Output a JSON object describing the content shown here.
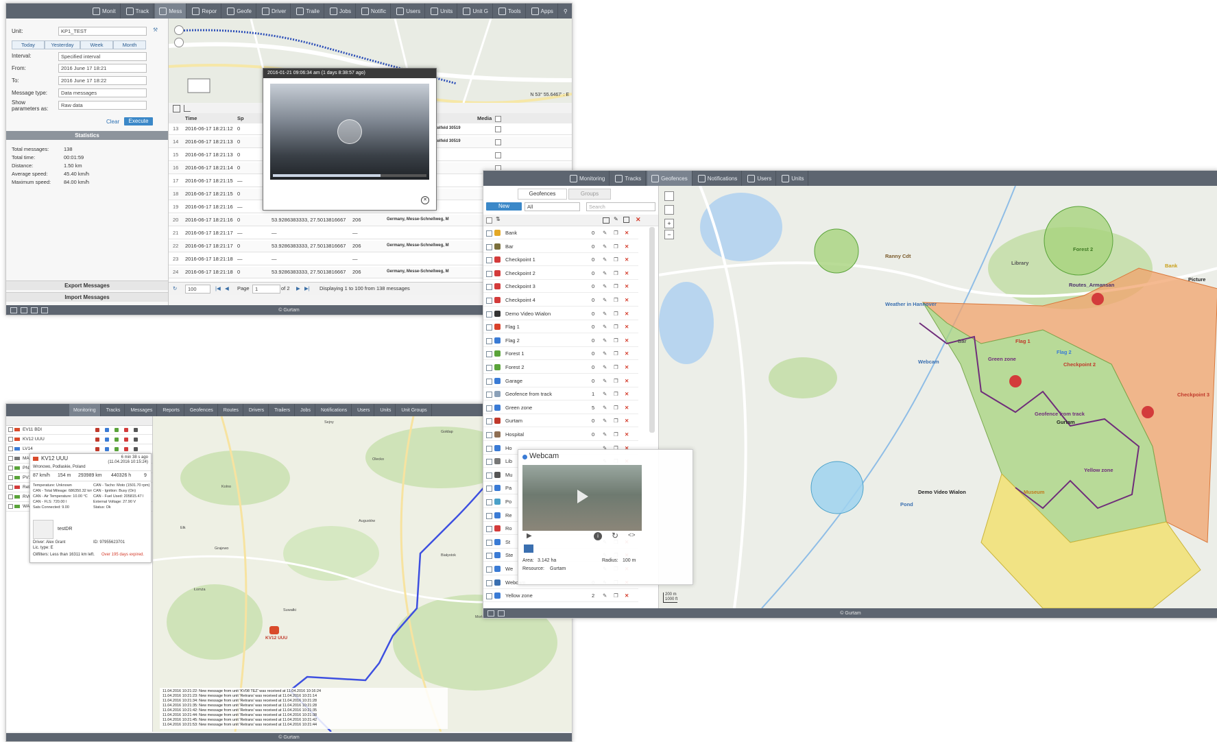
{
  "copyright": "© Gurtam",
  "s1": {
    "nav": [
      "Monit",
      "Track",
      "Mess",
      "Repor",
      "Geofe",
      "Driver",
      "Traile",
      "Jobs",
      "Notific",
      "Users",
      "Units",
      "Unit G",
      "Tools",
      "Apps"
    ],
    "form": {
      "unit_label": "Unit:",
      "unit_value": "KP1_TEST",
      "quick": [
        "Today",
        "Yesterday",
        "Week",
        "Month"
      ],
      "interval_label": "Interval:",
      "interval_value": "Specified interval",
      "from_label": "From:",
      "from_value": "2016 June 17 18:21",
      "to_label": "To:",
      "to_value": "2016 June 17 18:22",
      "msgtype_label": "Message type:",
      "msgtype_value": "Data messages",
      "show_label": "Show parameters as:",
      "show_value": "Raw data",
      "clear": "Clear",
      "execute": "Execute"
    },
    "stats_title": "Statistics",
    "stats": [
      {
        "k": "Total messages:",
        "v": "138"
      },
      {
        "k": "Total time:",
        "v": "00:01:59"
      },
      {
        "k": "Distance:",
        "v": "1.50 km"
      },
      {
        "k": "Average speed:",
        "v": "45.40 km/h"
      },
      {
        "k": "Maximum speed:",
        "v": "84.00 km/h"
      }
    ],
    "export": "Export Messages",
    "import": "Import Messages",
    "coords": "N 53° 55.6467' : E",
    "video_title": "2016-01-21 09:06:34 am (1 days 8:38:57 ago)",
    "table_headers": {
      "time": "Time",
      "sp": "Sp",
      "location": "on",
      "media": "Media"
    },
    "rows": [
      {
        "n": "13",
        "t": "2016-06-17 18:21:12",
        "s": "0",
        "c": "",
        "a": "",
        "l": "y, Messe-Schnellweg, Mittelfeld 30519"
      },
      {
        "n": "14",
        "t": "2016-06-17 18:21:13",
        "s": "0",
        "c": "",
        "a": "",
        "l": "y, Messe-Schnellweg, Mittelfeld 30519"
      },
      {
        "n": "15",
        "t": "2016-06-17 18:21:13",
        "s": "0",
        "c": "",
        "a": "",
        "l": ""
      },
      {
        "n": "16",
        "t": "2016-06-17 18:21:14",
        "s": "0",
        "c": "",
        "a": "",
        "l": "y, Messe-Schnellweg, M"
      },
      {
        "n": "17",
        "t": "2016-06-17 18:21:15",
        "s": "—",
        "c": "",
        "a": "",
        "l": ""
      },
      {
        "n": "18",
        "t": "2016-06-17 18:21:15",
        "s": "0",
        "c": "",
        "a": "",
        "l": "y, Messe-Schnellweg, M"
      },
      {
        "n": "19",
        "t": "2016-06-17 18:21:16",
        "s": "—",
        "c": "—",
        "a": "—",
        "l": ""
      },
      {
        "n": "20",
        "t": "2016-06-17 18:21:16",
        "s": "0",
        "c": "53.9286383333, 27.5013816667",
        "a": "206",
        "l": "Germany, Messe-Schnellweg, M"
      },
      {
        "n": "21",
        "t": "2016-06-17 18:21:17",
        "s": "—",
        "c": "—",
        "a": "—",
        "l": ""
      },
      {
        "n": "22",
        "t": "2016-06-17 18:21:17",
        "s": "0",
        "c": "53.9286383333, 27.5013816667",
        "a": "206",
        "l": "Germany, Messe-Schnellweg, M"
      },
      {
        "n": "23",
        "t": "2016-06-17 18:21:18",
        "s": "—",
        "c": "—",
        "a": "—",
        "l": ""
      },
      {
        "n": "24",
        "t": "2016-06-17 18:21:18",
        "s": "0",
        "c": "53.9286383333, 27.5013816667",
        "a": "206",
        "l": "Germany, Messe-Schnellweg, M"
      }
    ],
    "pager": {
      "size": "100",
      "page_label": "Page",
      "page": "1",
      "of": "of 2",
      "display": "Displaying 1 to 100 from 138 messages"
    }
  },
  "s2": {
    "nav": [
      "Monitoring",
      "Tracks",
      "Geofences",
      "Notifications",
      "Users",
      "Units"
    ],
    "tab_geofences": "Geofences",
    "tab_groups": "Groups",
    "new": "New",
    "filter": "All",
    "search_placeholder": "Search",
    "geofences": [
      {
        "name": "Bank",
        "count": "0",
        "color": "#e3a826"
      },
      {
        "name": "Bar",
        "count": "0",
        "color": "#7a6f3c"
      },
      {
        "name": "Checkpoint 1",
        "count": "0",
        "color": "#d33b3b"
      },
      {
        "name": "Checkpoint 2",
        "count": "0",
        "color": "#d33b3b"
      },
      {
        "name": "Checkpoint 3",
        "count": "0",
        "color": "#d33b3b"
      },
      {
        "name": "Checkpoint 4",
        "count": "0",
        "color": "#d33b3b"
      },
      {
        "name": "Demo Video Wialon",
        "count": "0",
        "color": "#333333"
      },
      {
        "name": "Flag 1",
        "count": "0",
        "color": "#d9412b"
      },
      {
        "name": "Flag 2",
        "count": "0",
        "color": "#3a7bd5"
      },
      {
        "name": "Forest 1",
        "count": "0",
        "color": "#5aa33a"
      },
      {
        "name": "Forest 2",
        "count": "0",
        "color": "#5aa33a"
      },
      {
        "name": "Garage",
        "count": "0",
        "color": "#3a7bd5"
      },
      {
        "name": "Geofence from track",
        "count": "1",
        "color": "#8aa0b8"
      },
      {
        "name": "Green zone",
        "count": "5",
        "color": "#3a7bd5"
      },
      {
        "name": "Gurtam",
        "count": "0",
        "color": "#c0392b"
      },
      {
        "name": "Hospital",
        "count": "0",
        "color": "#8e6e53"
      },
      {
        "name": "Ho",
        "count": "",
        "color": "#3a7bd5"
      },
      {
        "name": "Lib",
        "count": "",
        "color": "#777777"
      },
      {
        "name": "Mu",
        "count": "",
        "color": "#555555"
      },
      {
        "name": "Pa",
        "count": "",
        "color": "#3a7bd5"
      },
      {
        "name": "Po",
        "count": "",
        "color": "#4aa0c8"
      },
      {
        "name": "Re",
        "count": "",
        "color": "#3a7bd5"
      },
      {
        "name": "Ro",
        "count": "",
        "color": "#d33b3b"
      },
      {
        "name": "St",
        "count": "",
        "color": "#3a7bd5"
      },
      {
        "name": "Ste",
        "count": "",
        "color": "#3a7bd5"
      },
      {
        "name": "We",
        "count": "",
        "color": "#3a7bd5"
      },
      {
        "name": "Webcam",
        "count": "0",
        "color": "#3a6fb0"
      },
      {
        "name": "Yellow zone",
        "count": "2",
        "color": "#3a7bd5"
      }
    ],
    "webcam": {
      "title": "Webcam",
      "area_label": "Area:",
      "area": "3.142 ha",
      "radius_label": "Radius:",
      "radius": "100 m",
      "resource_label": "Resource:",
      "resource": "Gurtam"
    },
    "scale": [
      "200 m",
      "1000 ft"
    ],
    "map_labels": [
      {
        "t": "Forest 2",
        "c": "#3e7a23"
      },
      {
        "t": "Bank",
        "c": "#c9a01c"
      },
      {
        "t": "Picture",
        "c": "#222222"
      },
      {
        "t": "Routes_Armansan",
        "c": "#4a2f6a"
      },
      {
        "t": "Flag 2",
        "c": "#3a7bd5"
      },
      {
        "t": "Flag 1",
        "c": "#c0392b"
      },
      {
        "t": "Green zone",
        "c": "#6f2d7a"
      },
      {
        "t": "Checkpoint 2",
        "c": "#c0392b"
      },
      {
        "t": "Checkpoint 3",
        "c": "#c0392b"
      },
      {
        "t": "Geofence from track",
        "c": "#6f2d7a"
      },
      {
        "t": "Gurtam",
        "c": "#222222"
      },
      {
        "t": "Yellow zone",
        "c": "#6f2d7a"
      },
      {
        "t": "Museum",
        "c": "#c07a1c"
      },
      {
        "t": "Demo Video Wialon",
        "c": "#222222"
      },
      {
        "t": "Weather in Hannover",
        "c": "#3a6fb0"
      },
      {
        "t": "Webcam",
        "c": "#3a6fb0"
      },
      {
        "t": "Pond",
        "c": "#3a6fb0"
      },
      {
        "t": "Bar",
        "c": "#555555"
      },
      {
        "t": "Library",
        "c": "#555555"
      },
      {
        "t": "Ranny Cdt",
        "c": "#7a5a2a"
      }
    ]
  },
  "s3": {
    "nav": [
      "Monitoring",
      "Tracks",
      "Messages",
      "Reports",
      "Geofences",
      "Routes",
      "Drivers",
      "Trailers",
      "Jobs",
      "Notifications",
      "Users",
      "Units",
      "Unit Groups"
    ],
    "units": [
      "EV11 BDI",
      "KV12 UUU",
      "LV14",
      "MAG",
      "PN1",
      "PV1",
      "Retro",
      "RV0",
      "WA1"
    ],
    "popup": {
      "name": "KV12 UUU",
      "time": "6 min 38 s ago",
      "datetime": "(11.04.2016 10:15:24)",
      "address": "Wronowo, Podlaskie, Poland",
      "speed": "87 km/h",
      "alt": "154 m",
      "mileage": "293989 km",
      "hours": "440326 h",
      "sats": "9",
      "params_left": [
        "Temperature: Unknown",
        "CAN - Total Mileage: 686350.32 km",
        "CAN - Air Temperature: 10.00 °C",
        "CAN - FLS: 720.00 l",
        "Sats Connected: 9.00"
      ],
      "params_right": [
        "CAN - Tacho: Moto (1501.70 rpm)",
        "CAN - Ignition: Busy (On)",
        "CAN - Fuel Used: 205815.47 l",
        "External Voltage: 27.90 V",
        "Status: Ok"
      ],
      "driver_photo_label": "testDR",
      "driver": "Driver: Alex Grant",
      "driver_id": "ID: 97955623701",
      "lic": "Lic. type: E",
      "oilfilters": "Oilfilters: Less than 16311 km left.",
      "expired": "Over 195 days expired."
    },
    "unit_marker": "KV12 UUU",
    "log": [
      "11.04.2016 10:21:22: New message from unit 'KV08 TEZ' was received at 11.04.2016 10:16:24",
      "11.04.2016 10:21:23: New message from unit 'Retrans' was received at 11.04.2016 10:21:14",
      "11.04.2016 10:21:34: New message from unit 'Retrans' was received at 11.04.2016 10:21:28",
      "11.04.2016 10:21:35: New message from unit 'Retrans' was received at 11.04.2016 10:21:28",
      "11.04.2016 10:21:42: New message from unit 'Retrans' was received at 11.04.2016 10:21:35",
      "11.04.2016 10:21:44: New message from unit 'Retrans' was received at 11.04.2016 10:21:38",
      "11.04.2016 10:21:45: New message from unit 'Retrans' was received at 11.04.2016 10:21:42",
      "11.04.2016 10:21:53: New message from unit 'Retrans' was received at 11.04.2016 10:21:44"
    ],
    "towns": [
      "Sejny",
      "Suwałki",
      "Augustów",
      "Białystok",
      "Ełk",
      "Grajewo",
      "Łomża",
      "Olecko",
      "Gołdap",
      "Sokółka",
      "Mońki",
      "Kolno"
    ]
  }
}
